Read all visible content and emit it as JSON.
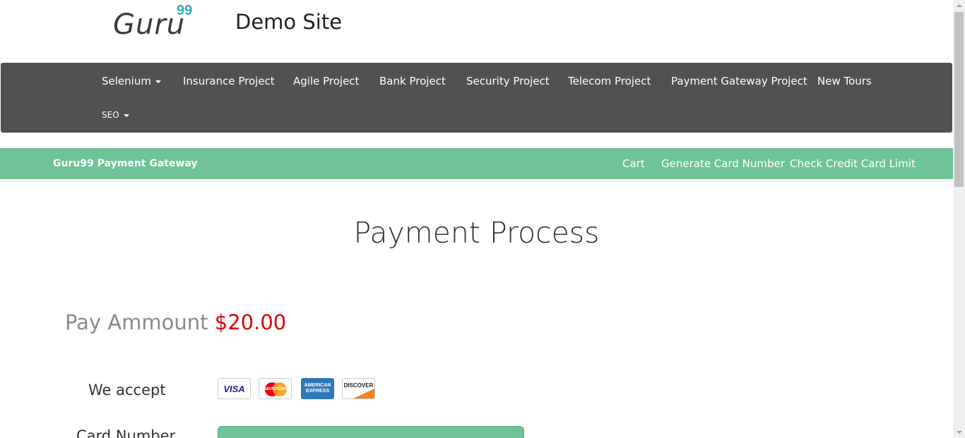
{
  "header": {
    "logo_text": "Guru",
    "logo_sup": "99",
    "site_title": "Demo Site"
  },
  "nav": {
    "items": [
      {
        "label": "Selenium",
        "dropdown": true
      },
      {
        "label": "Insurance Project"
      },
      {
        "label": "Agile Project"
      },
      {
        "label": "Bank Project"
      },
      {
        "label": "Security Project"
      },
      {
        "label": "Telecom Project"
      },
      {
        "label": "Payment Gateway Project"
      },
      {
        "label": "New Tours"
      },
      {
        "label": "SEO",
        "dropdown": true
      }
    ]
  },
  "subnav": {
    "brand": "Guru99 Payment Gateway",
    "links": [
      {
        "label": "Cart"
      },
      {
        "label": "Generate Card Number"
      },
      {
        "label": "Check Credit Card Limit"
      }
    ]
  },
  "main": {
    "title": "Payment Process",
    "pay_label": "Pay Ammount",
    "pay_amount": "$20.00",
    "accept_label": "We accept",
    "cards": [
      {
        "name": "VISA",
        "icon": "visa-card-icon"
      },
      {
        "name": "MasterCard",
        "icon": "mastercard-icon"
      },
      {
        "name": "AMERICAN EXPRESS",
        "icon": "amex-card-icon"
      },
      {
        "name": "DISCOVER",
        "icon": "discover-card-icon"
      }
    ],
    "card_number_label": "Card Number"
  },
  "colors": {
    "nav_bg": "#515151",
    "accent_green": "#6fc396",
    "amount_red": "#e00000",
    "logo_teal": "#3fa7b8"
  }
}
